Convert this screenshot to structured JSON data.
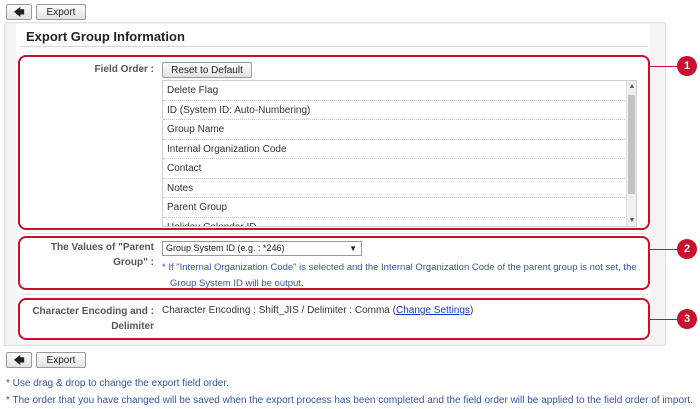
{
  "toolbar": {
    "back_glyph": "🡄",
    "export_label": "Export"
  },
  "title": "Export Group Information",
  "field_order": {
    "label": "Field Order :",
    "reset_label": "Reset to Default",
    "items": [
      "Delete Flag",
      "ID (System ID: Auto-Numbering)",
      "Group Name",
      "Internal Organization Code",
      "Contact",
      "Notes",
      "Parent Group",
      "Holiday Calendar ID"
    ]
  },
  "parent_group": {
    "label_line1": "The Values of \"Parent",
    "label_line2": "Group\" :",
    "selected": "Group System ID (e.g. : *246)",
    "note_line1": "* If \"Internal Organization Code\" is selected and the Internal Organization Code of the parent group is not set, the",
    "note_line2": "Group System ID will be output."
  },
  "encoding": {
    "label_line1": "Character Encoding and :",
    "label_line2": "Delimiter",
    "text_before": "Character Encoding : Shift_JIS / Delimiter : Comma (",
    "link": "Change Settings",
    "text_after": ")"
  },
  "callouts": [
    "1",
    "2",
    "3"
  ],
  "footer_notes": [
    "* Use drag & drop to change the export field order.",
    "* The order that you have changed will be saved when the export process has been completed and the field order will be applied to the field order of import."
  ],
  "colors": {
    "accent_red": "#c8102e",
    "note_blue": "#3355aa",
    "link_blue": "#1a33cc"
  }
}
